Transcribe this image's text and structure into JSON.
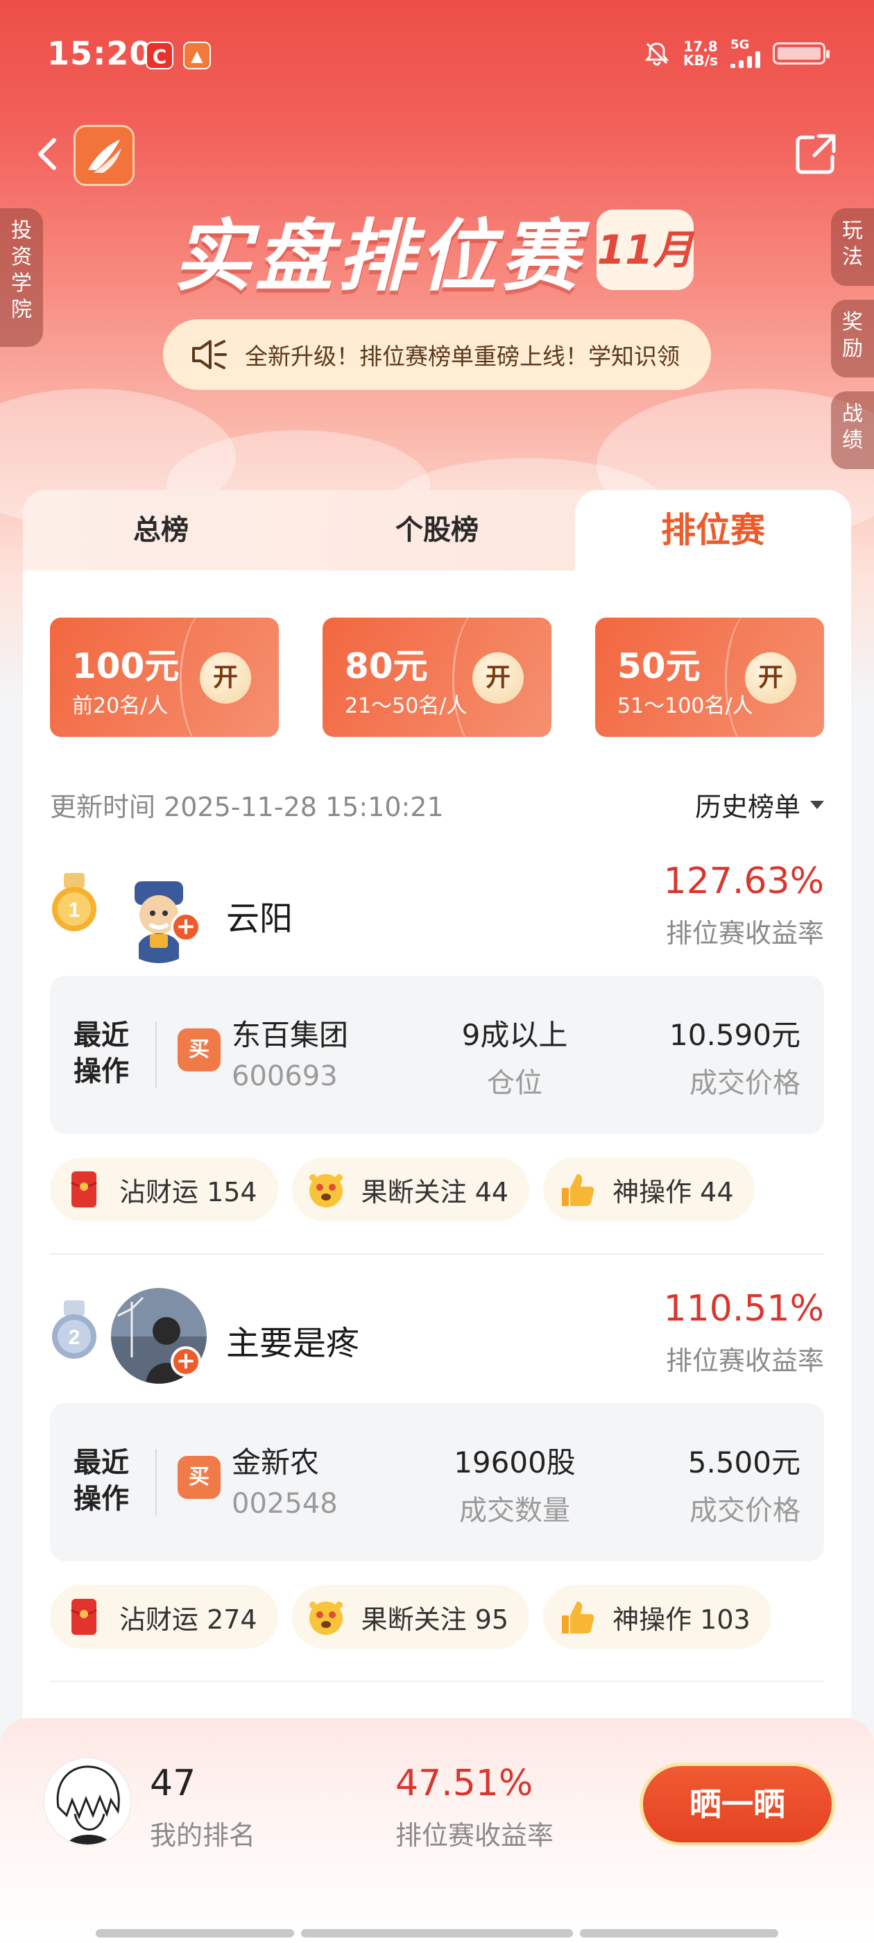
{
  "status_bar": {
    "time": "15:20",
    "net_speed_value": "17.8",
    "net_speed_unit": "KB/s",
    "network": "5G",
    "apps": [
      "C",
      "▲"
    ]
  },
  "header": {
    "title": "实盘排位赛",
    "month_badge": "11月",
    "notice": "全新升级！排位赛榜单重磅上线！学知识领"
  },
  "side_tabs": {
    "left": "投资学院",
    "right": [
      "玩法",
      "奖励",
      "战绩"
    ]
  },
  "tabs": [
    {
      "label": "总榜",
      "active": false
    },
    {
      "label": "个股榜",
      "active": false
    },
    {
      "label": "排位赛",
      "active": true
    }
  ],
  "prizes": [
    {
      "amount": "100元",
      "range": "前20名/人",
      "open": "开"
    },
    {
      "amount": "80元",
      "range": "21～50名/人",
      "open": "开"
    },
    {
      "amount": "50元",
      "range": "51～100名/人",
      "open": "开"
    }
  ],
  "update_time": "更新时间 2025-11-28 15:10:21",
  "history_label": "历史榜单",
  "entries": [
    {
      "rank": "1",
      "name": "云阳",
      "rate": "127.63%",
      "rate_label": "排位赛收益率",
      "op_title": "最近操作",
      "op_type": "买",
      "stock_name": "东百集团",
      "stock_code": "600693",
      "mid_value": "9成以上",
      "mid_label": "仓位",
      "price": "10.590元",
      "price_label": "成交价格",
      "reactions": [
        {
          "icon": "red-envelope-icon",
          "label": "沾财运 154"
        },
        {
          "icon": "excited-face-icon",
          "label": "果断关注 44"
        },
        {
          "icon": "thumbs-up-icon",
          "label": "神操作 44"
        }
      ]
    },
    {
      "rank": "2",
      "name": "主要是疼",
      "rate": "110.51%",
      "rate_label": "排位赛收益率",
      "op_title": "最近操作",
      "op_type": "买",
      "stock_name": "金新农",
      "stock_code": "002548",
      "mid_value": "19600股",
      "mid_label": "成交数量",
      "price": "5.500元",
      "price_label": "成交价格",
      "reactions": [
        {
          "icon": "red-envelope-icon",
          "label": "沾财运 274"
        },
        {
          "icon": "excited-face-icon",
          "label": "果断关注 95"
        },
        {
          "icon": "thumbs-up-icon",
          "label": "神操作 103"
        }
      ]
    }
  ],
  "my_stats": {
    "rank": "47",
    "rank_label": "我的排名",
    "rate": "47.51%",
    "rate_label": "排位赛收益率",
    "button": "晒一晒"
  },
  "colors": {
    "accent_red": "#d9362e",
    "orange": "#ef5a2a",
    "header_red": "#ec4e46"
  }
}
